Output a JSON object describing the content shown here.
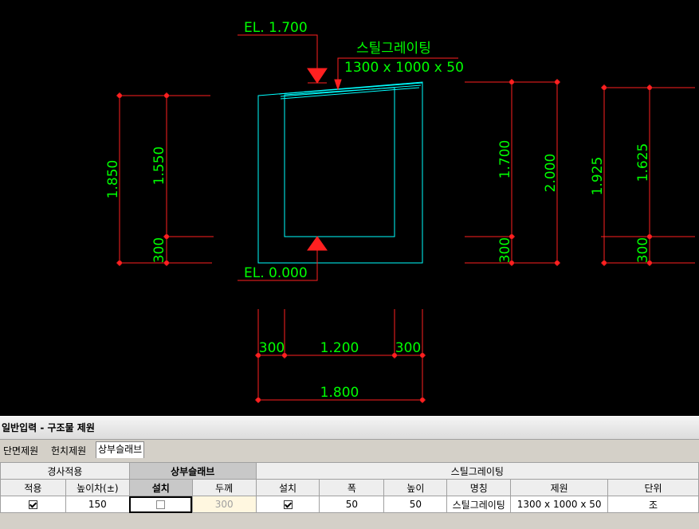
{
  "drawing": {
    "el_top": "EL. 1.700",
    "el_bottom": "EL. 0.000",
    "grating_title": "스틸그레이팅",
    "grating_size": "1300 x 1000 x 50",
    "left_dims": {
      "outer": "1.850",
      "inner": "1.550",
      "base": "300"
    },
    "right1_dims": {
      "inner": "1.700",
      "outer": "2.000",
      "base": "300"
    },
    "right2_dims": {
      "outer": "1.925",
      "inner": "1.625",
      "base": "300"
    },
    "bottom_dims": {
      "left_wall": "300",
      "inner": "1.200",
      "right_wall": "300",
      "total": "1.800"
    },
    "colors": {
      "dimension": "#ff2020",
      "text": "#00ff00",
      "outline": "#00ffff",
      "background": "#000000"
    }
  },
  "panel": {
    "title": "일반입력 - 구조물 제원",
    "tabs": [
      "단면제원",
      "헌치제원",
      "상부슬래브"
    ],
    "active_tab": 2,
    "group_headers": {
      "slope": "경사적용",
      "slab": "상부슬래브",
      "grating": "스틸그레이팅"
    },
    "columns": [
      "적용",
      "높이차(±)",
      "설치",
      "두께",
      "설치",
      "폭",
      "높이",
      "명칭",
      "제원",
      "단위"
    ],
    "row": {
      "slope_apply": true,
      "height_diff": "150",
      "slab_install": false,
      "slab_thickness": "300",
      "grating_install": true,
      "width": "50",
      "height": "50",
      "name": "스틸그레이팅",
      "spec": "1300 x 1000 x 50",
      "unit": "조"
    }
  }
}
